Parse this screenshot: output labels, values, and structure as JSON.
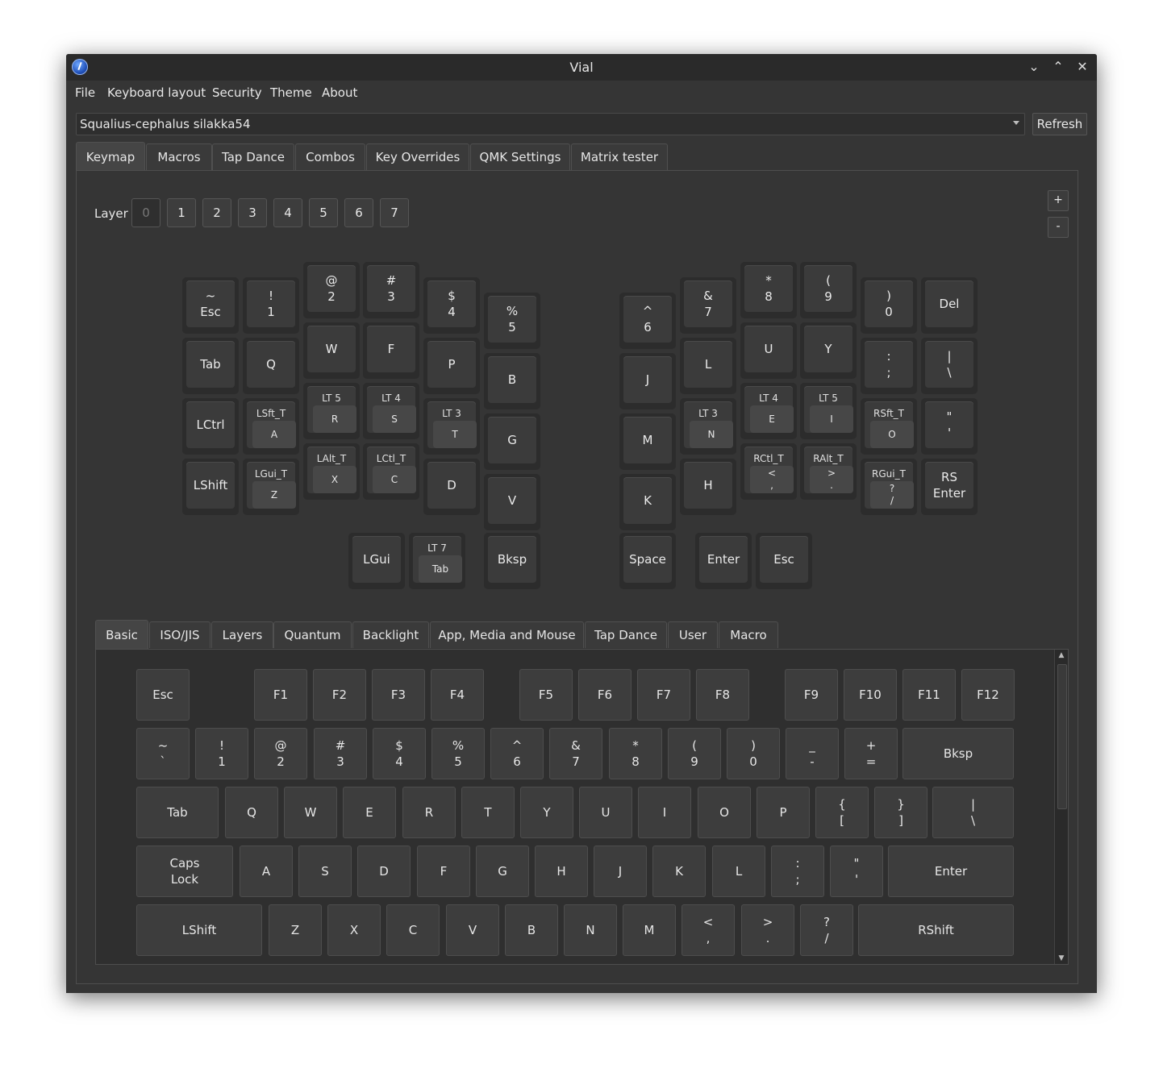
{
  "window": {
    "title": "Vial"
  },
  "menu": [
    "File",
    "Keyboard layout",
    "Security",
    "Theme",
    "About"
  ],
  "device": {
    "selected": "Squalius-cephalus silakka54",
    "refresh_label": "Refresh"
  },
  "main_tabs": [
    "Keymap",
    "Macros",
    "Tap Dance",
    "Combos",
    "Key Overrides",
    "QMK Settings",
    "Matrix tester"
  ],
  "active_main_tab": "Keymap",
  "layer": {
    "label": "Layer",
    "buttons": [
      "0",
      "1",
      "2",
      "3",
      "4",
      "5",
      "6",
      "7"
    ],
    "selected": "0",
    "add_label": "+",
    "remove_label": "-"
  },
  "keymap": {
    "left": [
      {
        "lines": [
          "~",
          "Esc"
        ]
      },
      {
        "lines": [
          "!",
          "1"
        ]
      },
      {
        "lines": [
          "@",
          "2"
        ]
      },
      {
        "lines": [
          "#",
          "3"
        ]
      },
      {
        "lines": [
          "$",
          "4"
        ]
      },
      {
        "lines": [
          "%",
          "5"
        ]
      },
      {
        "lines": [
          "Tab"
        ]
      },
      {
        "lines": [
          "Q"
        ]
      },
      {
        "lines": [
          "W"
        ]
      },
      {
        "lines": [
          "F"
        ]
      },
      {
        "lines": [
          "P"
        ]
      },
      {
        "lines": [
          "B"
        ]
      },
      {
        "lines": [
          "LCtrl"
        ]
      },
      {
        "mod": "LSft_T",
        "lines": [
          "A"
        ]
      },
      {
        "mod": "LT 5",
        "lines": [
          "R"
        ]
      },
      {
        "mod": "LT 4",
        "lines": [
          "S"
        ]
      },
      {
        "mod": "LT 3",
        "lines": [
          "T"
        ]
      },
      {
        "lines": [
          "G"
        ]
      },
      {
        "lines": [
          "LShift"
        ]
      },
      {
        "mod": "LGui_T",
        "lines": [
          "Z"
        ]
      },
      {
        "mod": "LAlt_T",
        "lines": [
          "X"
        ]
      },
      {
        "mod": "LCtl_T",
        "lines": [
          "C"
        ]
      },
      {
        "lines": [
          "D"
        ]
      },
      {
        "lines": [
          "V"
        ]
      }
    ],
    "right": [
      {
        "lines": [
          "^",
          "6"
        ]
      },
      {
        "lines": [
          "&",
          "7"
        ]
      },
      {
        "lines": [
          "*",
          "8"
        ]
      },
      {
        "lines": [
          "(",
          "9"
        ]
      },
      {
        "lines": [
          ")",
          "0"
        ]
      },
      {
        "lines": [
          "Del"
        ]
      },
      {
        "lines": [
          "J"
        ]
      },
      {
        "lines": [
          "L"
        ]
      },
      {
        "lines": [
          "U"
        ]
      },
      {
        "lines": [
          "Y"
        ]
      },
      {
        "lines": [
          ":",
          ";"
        ]
      },
      {
        "lines": [
          "|",
          "\\"
        ]
      },
      {
        "lines": [
          "M"
        ]
      },
      {
        "mod": "LT 3",
        "lines": [
          "N"
        ]
      },
      {
        "mod": "LT 4",
        "lines": [
          "E"
        ]
      },
      {
        "mod": "LT 5",
        "lines": [
          "I"
        ]
      },
      {
        "mod": "RSft_T",
        "lines": [
          "O"
        ]
      },
      {
        "lines": [
          "\"",
          "'"
        ]
      },
      {
        "lines": [
          "K"
        ]
      },
      {
        "lines": [
          "H"
        ]
      },
      {
        "mod": "RCtl_T",
        "lines": [
          "<",
          ","
        ]
      },
      {
        "mod": "RAlt_T",
        "lines": [
          ">",
          "."
        ]
      },
      {
        "mod": "RGui_T",
        "lines": [
          "?",
          "/"
        ]
      },
      {
        "lines": [
          "RS",
          "Enter"
        ]
      }
    ],
    "thumbs": [
      {
        "lines": [
          "LGui"
        ]
      },
      {
        "mod": "LT 7",
        "lines": [
          "Tab"
        ]
      },
      {
        "lines": [
          "Bksp"
        ]
      },
      {
        "lines": [
          "Space"
        ]
      },
      {
        "lines": [
          "Enter"
        ]
      },
      {
        "lines": [
          "Esc"
        ]
      }
    ]
  },
  "bottom_tabs": [
    "Basic",
    "ISO/JIS",
    "Layers",
    "Quantum",
    "Backlight",
    "App, Media and Mouse",
    "Tap Dance",
    "User",
    "Macro"
  ],
  "active_bottom_tab": "Basic",
  "basic_keys": {
    "row1": [
      [
        "Esc"
      ],
      [
        "F1"
      ],
      [
        "F2"
      ],
      [
        "F3"
      ],
      [
        "F4"
      ],
      [
        "F5"
      ],
      [
        "F6"
      ],
      [
        "F7"
      ],
      [
        "F8"
      ],
      [
        "F9"
      ],
      [
        "F10"
      ],
      [
        "F11"
      ],
      [
        "F12"
      ]
    ],
    "row2": [
      [
        "~",
        "`"
      ],
      [
        "!",
        "1"
      ],
      [
        "@",
        "2"
      ],
      [
        "#",
        "3"
      ],
      [
        "$",
        "4"
      ],
      [
        "%",
        "5"
      ],
      [
        "^",
        "6"
      ],
      [
        "&",
        "7"
      ],
      [
        "*",
        "8"
      ],
      [
        "(",
        "9"
      ],
      [
        ")",
        "0"
      ],
      [
        "_",
        "-"
      ],
      [
        "+",
        "="
      ],
      [
        "Bksp"
      ]
    ],
    "row3": [
      [
        "Tab"
      ],
      [
        "Q"
      ],
      [
        "W"
      ],
      [
        "E"
      ],
      [
        "R"
      ],
      [
        "T"
      ],
      [
        "Y"
      ],
      [
        "U"
      ],
      [
        "I"
      ],
      [
        "O"
      ],
      [
        "P"
      ],
      [
        "{",
        "["
      ],
      [
        "}",
        "]"
      ],
      [
        "|",
        "\\"
      ]
    ],
    "row4": [
      [
        "Caps",
        "Lock"
      ],
      [
        "A"
      ],
      [
        "S"
      ],
      [
        "D"
      ],
      [
        "F"
      ],
      [
        "G"
      ],
      [
        "H"
      ],
      [
        "J"
      ],
      [
        "K"
      ],
      [
        "L"
      ],
      [
        ":",
        ";"
      ],
      [
        "\"",
        "'"
      ],
      [
        "Enter"
      ]
    ],
    "row5": [
      [
        "LShift"
      ],
      [
        "Z"
      ],
      [
        "X"
      ],
      [
        "C"
      ],
      [
        "V"
      ],
      [
        "B"
      ],
      [
        "N"
      ],
      [
        "M"
      ],
      [
        "<",
        ","
      ],
      [
        ">",
        "."
      ],
      [
        "?",
        "/"
      ],
      [
        "RShift"
      ]
    ]
  }
}
